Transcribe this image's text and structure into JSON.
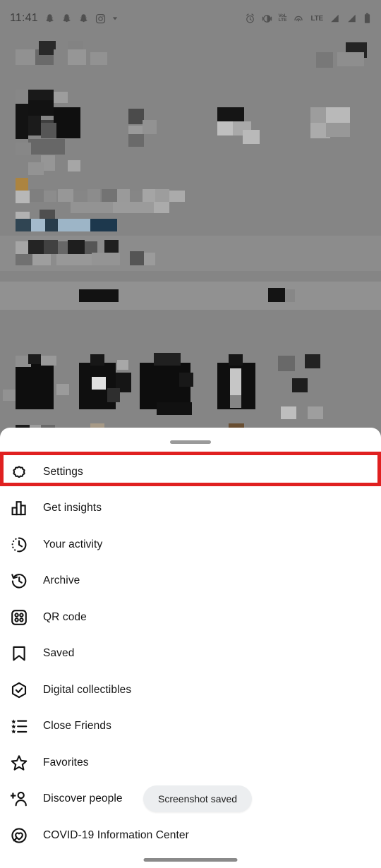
{
  "status_bar": {
    "time": "11:41",
    "left_icons": [
      "snapchat-ghost-icon",
      "snapchat-ghost-icon",
      "snapchat-ghost-icon",
      "instagram-camera-icon",
      "more-notifications-icon"
    ],
    "right_icons": [
      "alarm-icon",
      "vibrate-icon",
      "volte-icon",
      "hotspot-icon",
      "lte-label",
      "signal-bars-1-icon",
      "signal-bars-2-icon",
      "battery-icon"
    ],
    "network_label": "LTE",
    "volte_label_top": "VoL",
    "volte_label_bottom": "LTE"
  },
  "sheet": {
    "grabber": "drag-handle",
    "menu": [
      {
        "id": "settings",
        "label": "Settings",
        "icon": "gear-icon",
        "highlighted": true
      },
      {
        "id": "get-insights",
        "label": "Get insights",
        "icon": "bar-chart-icon",
        "highlighted": false
      },
      {
        "id": "your-activity",
        "label": "Your activity",
        "icon": "activity-clock-icon",
        "highlighted": false
      },
      {
        "id": "archive",
        "label": "Archive",
        "icon": "archive-clock-arrow-icon",
        "highlighted": false
      },
      {
        "id": "qr-code",
        "label": "QR code",
        "icon": "qr-code-icon",
        "highlighted": false
      },
      {
        "id": "saved",
        "label": "Saved",
        "icon": "bookmark-icon",
        "highlighted": false
      },
      {
        "id": "digital-collectibles",
        "label": "Digital collectibles",
        "icon": "hexagon-check-icon",
        "highlighted": false
      },
      {
        "id": "close-friends",
        "label": "Close Friends",
        "icon": "star-list-icon",
        "highlighted": false
      },
      {
        "id": "favorites",
        "label": "Favorites",
        "icon": "star-icon",
        "highlighted": false
      },
      {
        "id": "discover-people",
        "label": "Discover people",
        "icon": "person-plus-icon",
        "highlighted": false
      },
      {
        "id": "covid-info-center",
        "label": "COVID-19 Information Center",
        "icon": "covid-heart-circle-icon",
        "highlighted": false
      }
    ]
  },
  "toast": {
    "message": "Screenshot saved"
  },
  "highlight": {
    "color": "#e02020",
    "target": "settings"
  },
  "background": {
    "description": "blurred and pixelated Instagram profile page behind the modal sheet",
    "dim_color": "#8c8c8c"
  },
  "home_indicator": "home-gesture-bar"
}
